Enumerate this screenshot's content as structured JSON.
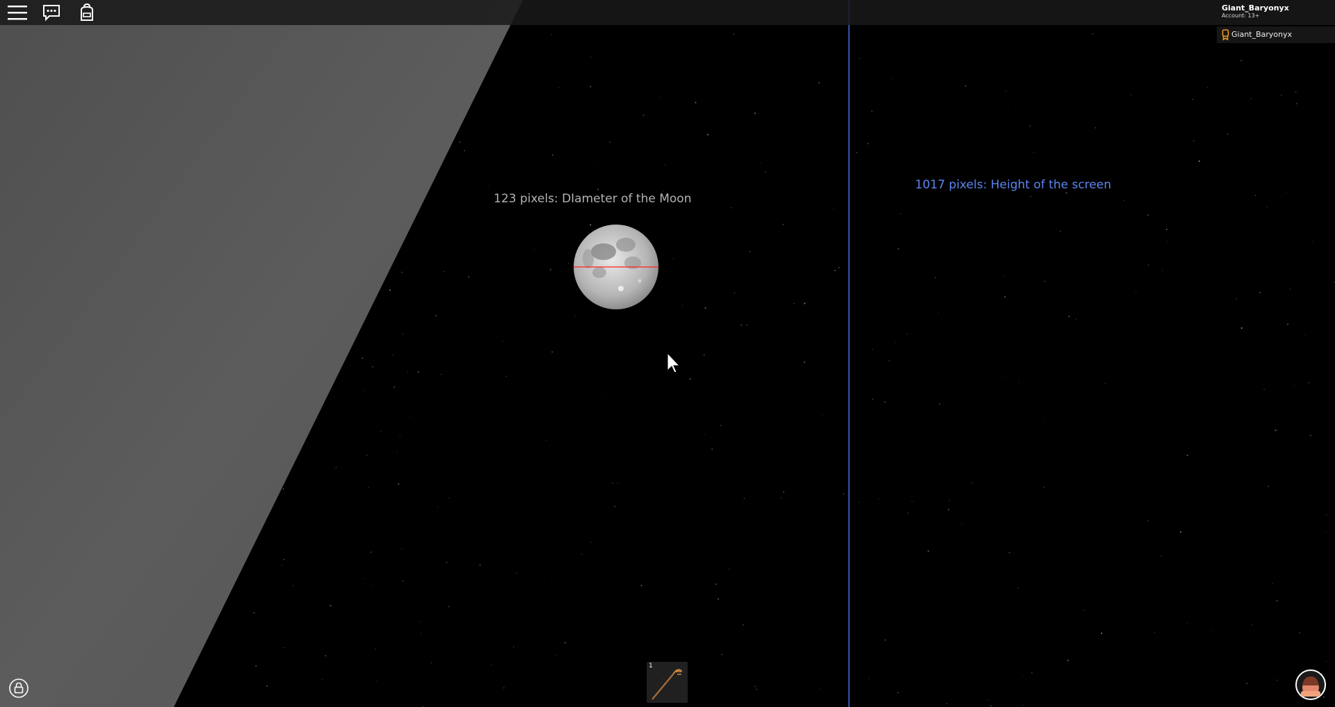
{
  "topbar": {
    "menu_icon": "hamburger-menu-icon",
    "chat_icon": "chat-bubble-icon",
    "backpack_icon": "backpack-icon"
  },
  "user": {
    "name": "Giant_Baryonyx",
    "account": "Account: 13+"
  },
  "players": [
    {
      "name": "Giant_Baryonyx",
      "icon": "premium-badge-icon"
    }
  ],
  "labels": {
    "moon": "123 pixels: DIameter of the Moon",
    "screen": "1017 pixels: Height of the screen"
  },
  "hotbar": {
    "slots": [
      {
        "number": "1",
        "item": "staff-tool-icon"
      }
    ]
  },
  "colors": {
    "sky": "#000000",
    "wall": "#5a5a5a",
    "measure_line": "#4a6fe0",
    "moon_diameter_line": "#ff2020",
    "screen_label": "#5b86f0",
    "moon_label": "#b3b3b3"
  }
}
